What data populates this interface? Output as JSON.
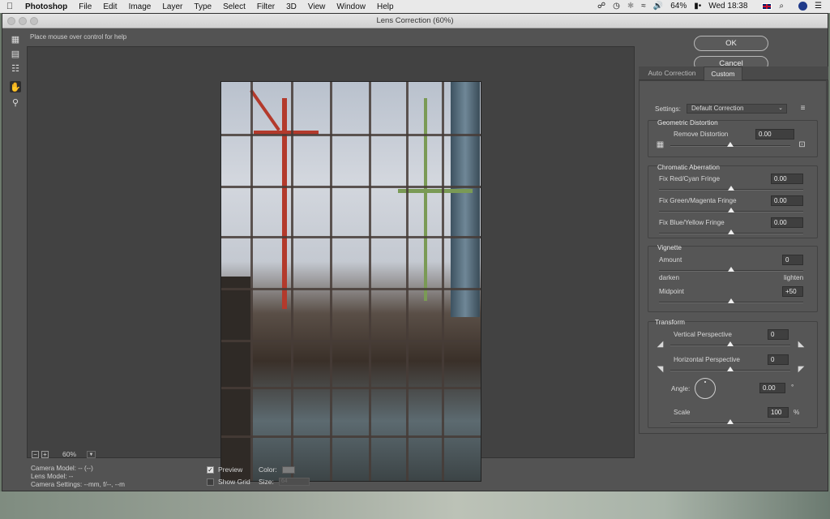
{
  "menubar": {
    "app_name": "Photoshop",
    "items": [
      "File",
      "Edit",
      "Image",
      "Layer",
      "Type",
      "Select",
      "Filter",
      "3D",
      "View",
      "Window",
      "Help"
    ],
    "battery": "64%",
    "clock": "Wed 18:38"
  },
  "window": {
    "title": "Lens Correction (60%)",
    "help_text": "Place mouse over control for help"
  },
  "tools": [
    "remove-distortion-tool",
    "straighten-tool",
    "move-grid-tool",
    "hand-tool",
    "zoom-tool"
  ],
  "preview": {
    "zoom_minus": "−",
    "zoom_plus": "+",
    "zoom_level": "60%"
  },
  "camera_info": {
    "camera_model": "Camera Model: -- (--)",
    "lens_model": "Lens Model: --",
    "camera_settings": "Camera Settings: --mm, f/--, --m"
  },
  "options": {
    "preview_label": "Preview",
    "preview_checked": true,
    "show_grid_label": "Show Grid",
    "show_grid_checked": false,
    "color_label": "Color:",
    "size_label": "Size:",
    "size_value": "64",
    "grid_color": "#7d7d7d"
  },
  "buttons": {
    "ok": "OK",
    "cancel": "Cancel"
  },
  "tabs": {
    "auto": "Auto Correction",
    "custom": "Custom"
  },
  "settings": {
    "label": "Settings:",
    "value": "Default Correction"
  },
  "geometric": {
    "heading": "Geometric Distortion",
    "remove_label": "Remove Distortion",
    "remove_value": "0.00",
    "remove_level": 0.5
  },
  "chromatic": {
    "heading": "Chromatic Aberration",
    "red_label": "Fix Red/Cyan Fringe",
    "red_value": "0.00",
    "green_label": "Fix Green/Magenta Fringe",
    "green_value": "0.00",
    "blue_label": "Fix Blue/Yellow Fringe",
    "blue_value": "0.00"
  },
  "vignette": {
    "heading": "Vignette",
    "amount_label": "Amount",
    "amount_value": "0",
    "darken": "darken",
    "lighten": "lighten",
    "midpoint_label": "Midpoint",
    "midpoint_value": "+50"
  },
  "transform": {
    "heading": "Transform",
    "vertical_label": "Vertical Perspective",
    "vertical_value": "0",
    "horizontal_label": "Horizontal Perspective",
    "horizontal_value": "0",
    "angle_label": "Angle:",
    "angle_value": "0.00",
    "angle_unit": "°",
    "scale_label": "Scale",
    "scale_value": "100",
    "scale_unit": "%"
  }
}
